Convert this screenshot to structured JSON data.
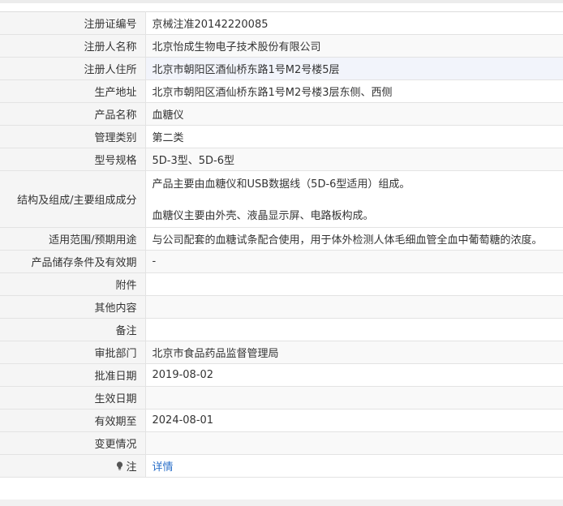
{
  "rows": [
    {
      "label": "注册证编号",
      "value": "京械注准20142220085"
    },
    {
      "label": "注册人名称",
      "value": "北京怡成生物电子技术股份有限公司"
    },
    {
      "label": "注册人住所",
      "value": "北京市朝阳区酒仙桥东路1号M2号楼5层"
    },
    {
      "label": "生产地址",
      "value": "北京市朝阳区酒仙桥东路1号M2号楼3层东侧、西侧"
    },
    {
      "label": "产品名称",
      "value": "血糖仪"
    },
    {
      "label": "管理类别",
      "value": "第二类"
    },
    {
      "label": "型号规格",
      "value": "5D-3型、5D-6型"
    },
    {
      "label": "结构及组成/主要组成成分",
      "value_line1": "产品主要由血糖仪和USB数据线（5D-6型适用）组成。",
      "value_line2": "血糖仪主要由外壳、液晶显示屏、电路板构成。"
    },
    {
      "label": "适用范围/预期用途",
      "value": "与公司配套的血糖试条配合使用，用于体外检测人体毛细血管全血中葡萄糖的浓度。"
    },
    {
      "label": "产品储存条件及有效期",
      "value": "-"
    },
    {
      "label": "附件",
      "value": ""
    },
    {
      "label": "其他内容",
      "value": ""
    },
    {
      "label": "备注",
      "value": ""
    },
    {
      "label": "审批部门",
      "value": "北京市食品药品监督管理局"
    },
    {
      "label": "批准日期",
      "value": "2019-08-02"
    },
    {
      "label": "生效日期",
      "value": ""
    },
    {
      "label": "有效期至",
      "value": "2024-08-01"
    },
    {
      "label": "变更情况",
      "value": ""
    },
    {
      "label": "注",
      "value": "详情"
    }
  ],
  "icons": {
    "note": "lightbulb-icon"
  },
  "colors": {
    "link": "#2a6fc9",
    "label_bg": "#f5f5f5",
    "highlight_row": "#f2f4fb"
  }
}
